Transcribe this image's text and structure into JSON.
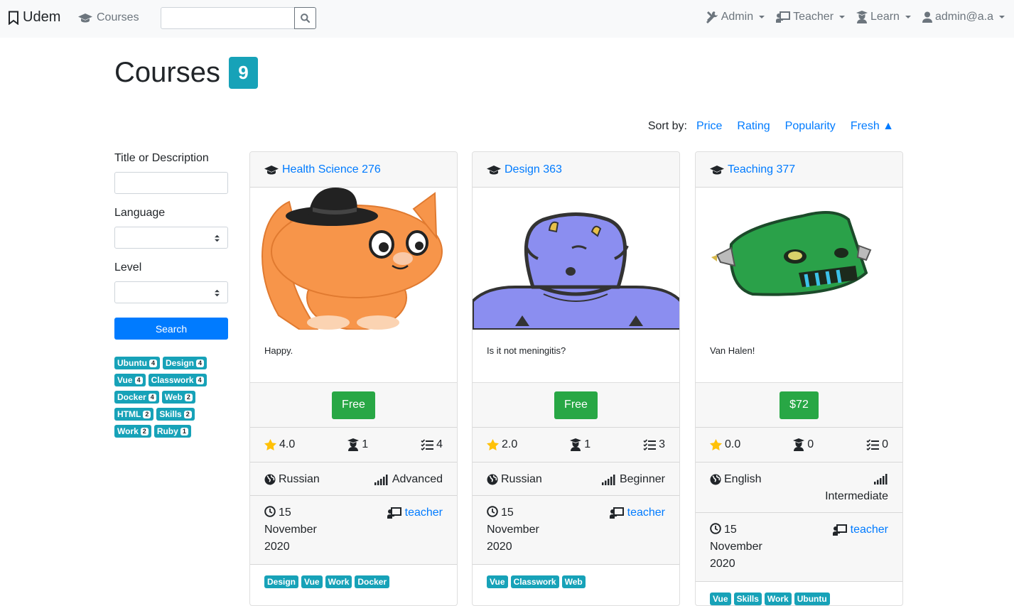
{
  "navbar": {
    "brand": "Udem",
    "courses_link": "Courses",
    "search_placeholder": "",
    "menus": [
      {
        "label": "Admin",
        "icon": "tools-icon"
      },
      {
        "label": "Teacher",
        "icon": "chalkboard-teacher-icon"
      },
      {
        "label": "Learn",
        "icon": "graduate-icon"
      },
      {
        "label": "admin@a.a",
        "icon": "user-icon"
      }
    ]
  },
  "page": {
    "title": "Courses",
    "count": "9"
  },
  "sort": {
    "label": "Sort by:",
    "options": [
      "Price",
      "Rating",
      "Popularity",
      "Fresh ▲"
    ]
  },
  "filters": {
    "title_label": "Title or Description",
    "title_value": "",
    "language_label": "Language",
    "language_value": "",
    "level_label": "Level",
    "level_value": "",
    "search_button": "Search",
    "tags": [
      {
        "name": "Ubuntu",
        "count": "4"
      },
      {
        "name": "Design",
        "count": "4"
      },
      {
        "name": "Vue",
        "count": "4"
      },
      {
        "name": "Classwork",
        "count": "4"
      },
      {
        "name": "Docker",
        "count": "4"
      },
      {
        "name": "Web",
        "count": "2"
      },
      {
        "name": "HTML",
        "count": "2"
      },
      {
        "name": "Skills",
        "count": "2"
      },
      {
        "name": "Work",
        "count": "2"
      },
      {
        "name": "Ruby",
        "count": "1"
      }
    ]
  },
  "courses": [
    {
      "title": "Health Science 276",
      "image": "orange-cat-with-hat",
      "description": "Happy.",
      "price": "Free",
      "rating": "4.0",
      "students": "1",
      "lessons": "4",
      "language": "Russian",
      "level": "Advanced",
      "date": "15 November 2020",
      "teacher": "teacher",
      "tags": [
        "Design",
        "Vue",
        "Work",
        "Docker"
      ]
    },
    {
      "title": "Design 363",
      "image": "blue-monster",
      "description": "Is it not meningitis?",
      "price": "Free",
      "rating": "2.0",
      "students": "1",
      "lessons": "3",
      "language": "Russian",
      "level": "Beginner",
      "date": "15 November 2020",
      "teacher": "teacher",
      "tags": [
        "Vue",
        "Classwork",
        "Web"
      ]
    },
    {
      "title": "Teaching 377",
      "image": "green-robot",
      "description": "Van Halen!",
      "price": "$72",
      "rating": "0.0",
      "students": "0",
      "lessons": "0",
      "language": "English",
      "level": "Intermediate",
      "date": "15 November 2020",
      "teacher": "teacher",
      "tags": [
        "Vue",
        "Skills",
        "Work",
        "Ubuntu"
      ]
    }
  ]
}
